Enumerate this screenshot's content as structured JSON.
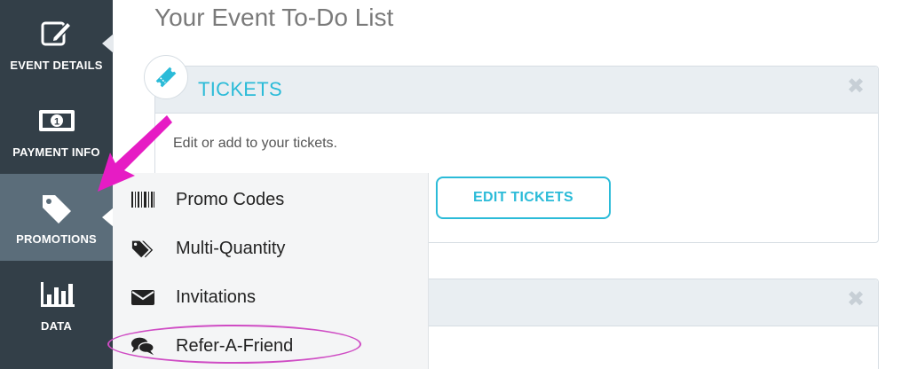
{
  "sidebar": {
    "items": [
      {
        "label": "EVENT DETAILS",
        "icon": "edit-icon"
      },
      {
        "label": "PAYMENT INFO",
        "icon": "money-icon"
      },
      {
        "label": "PROMOTIONS",
        "icon": "tag-icon"
      },
      {
        "label": "DATA",
        "icon": "bar-chart-icon"
      }
    ]
  },
  "main": {
    "title": "Your Event To-Do List",
    "tickets_card": {
      "title": "TICKETS",
      "description": "Edit or add to your tickets.",
      "button": "EDIT TICKETS"
    }
  },
  "dropdown": {
    "items": [
      {
        "label": "Promo Codes",
        "icon": "barcode-icon"
      },
      {
        "label": "Multi-Quantity",
        "icon": "tags-icon"
      },
      {
        "label": "Invitations",
        "icon": "envelope-icon"
      },
      {
        "label": "Refer-A-Friend",
        "icon": "chat-icon"
      }
    ]
  },
  "colors": {
    "sidebar_bg": "#333f48",
    "sidebar_active": "#5b6d7a",
    "accent": "#2bbbd8",
    "annotation": "#cf4cc4"
  }
}
